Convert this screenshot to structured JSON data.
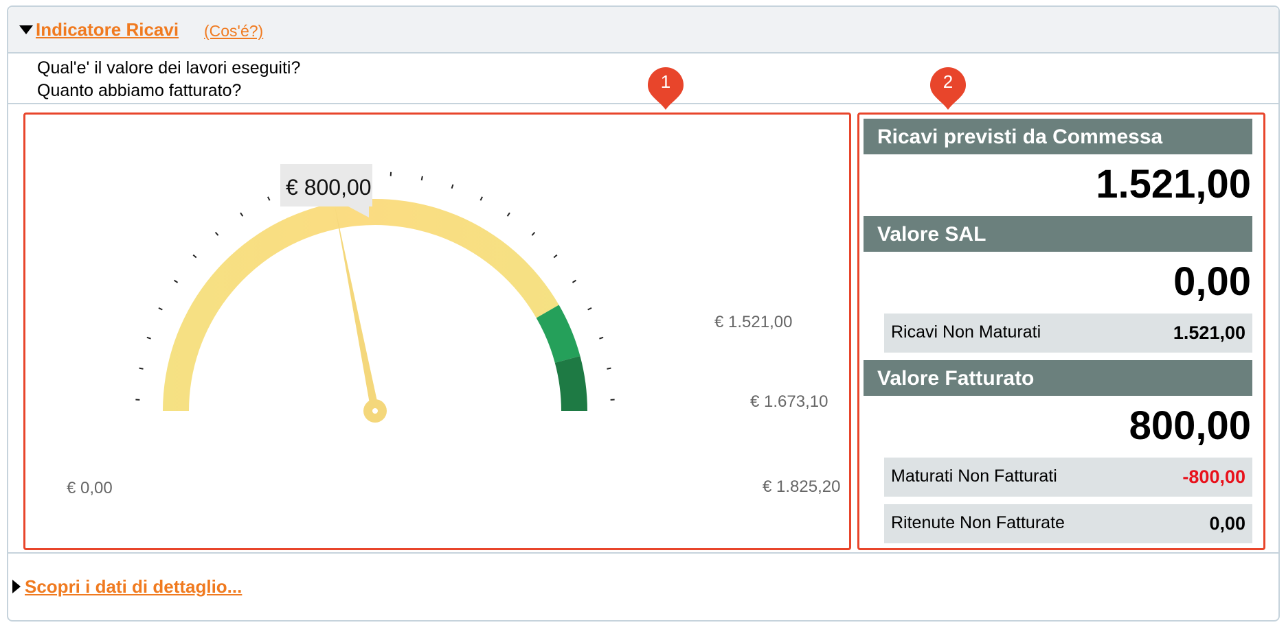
{
  "header": {
    "title": "Indicatore Ricavi",
    "cose_link": "(Cos'é?)",
    "question_1": "Qual'e' il valore dei lavori eseguiti?",
    "question_2": "Quanto abbiamo fatturato?"
  },
  "markers": {
    "one": "1",
    "two": "2"
  },
  "gauge": {
    "min": 0,
    "max": 1825.2,
    "value": 800,
    "value_label": "€ 800,00",
    "label_min": "€ 0,00",
    "label_threshold_1": "€ 1.521,00",
    "label_threshold_2": "€ 1.673,10",
    "label_max": "€ 1.825,20",
    "threshold_1": 1521,
    "threshold_2": 1673.1,
    "colors": {
      "band": "#f7e08a",
      "band_light": "#f4d77b",
      "green": "#25a05a",
      "dark_green": "#1e7a44",
      "needle": "#f4d77b",
      "ticks": "#222222"
    }
  },
  "summary": {
    "ricavi_previsti": {
      "label": "Ricavi previsti da Commessa",
      "value": "1.521,00"
    },
    "valore_sal": {
      "label": "Valore SAL",
      "value": "0,00"
    },
    "ricavi_non_maturati": {
      "label": "Ricavi Non Maturati",
      "value": "1.521,00"
    },
    "valore_fatturato": {
      "label": "Valore Fatturato",
      "value": "800,00"
    },
    "maturati_non_fatturati": {
      "label": "Maturati Non Fatturati",
      "value": "-800,00"
    },
    "ritenute_non_fatturate": {
      "label": "Ritenute Non Fatturate",
      "value": "0,00"
    }
  },
  "footer": {
    "detail_link": "Scopri i dati di dettaglio..."
  }
}
